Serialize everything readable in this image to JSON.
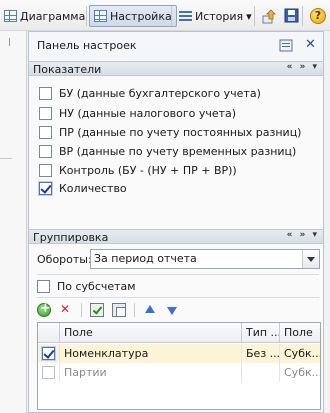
{
  "toolbar": {
    "diagram_label": "Диаграмма",
    "settings_label": "Настройка",
    "history_label": "История",
    "history_dropdown": "▾",
    "help_glyph": "?"
  },
  "panel": {
    "title": "Панель настроек",
    "close_glyph": "✕"
  },
  "indicators": {
    "title": "Показатели",
    "nav": "« » ▾",
    "items": [
      {
        "label": "БУ (данные бухгалтерского учета)",
        "checked": false
      },
      {
        "label": "НУ (данные налогового учета)",
        "checked": false
      },
      {
        "label": "ПР (данные по учету постоянных разниц)",
        "checked": false
      },
      {
        "label": "ВР (данные по учету временных разниц)",
        "checked": false
      },
      {
        "label": "Контроль (БУ - (НУ + ПР + ВР))",
        "checked": false
      },
      {
        "label": "Количество",
        "checked": true
      }
    ]
  },
  "grouping": {
    "title": "Группировка",
    "nav": "« » ▾",
    "turnover_label": "Обороты:",
    "turnover_value": "За период отчета",
    "by_subaccounts_label": "По субсчетам",
    "by_subaccounts_checked": false,
    "table": {
      "columns": [
        "Поле",
        "Тип ...",
        "Поле"
      ],
      "rows": [
        {
          "checked": true,
          "field": "Номенклатура",
          "type": "Без ...",
          "field2": "Субк..."
        },
        {
          "checked": false,
          "field": "Партии",
          "type": "",
          "field2": "Субк..."
        }
      ]
    }
  }
}
